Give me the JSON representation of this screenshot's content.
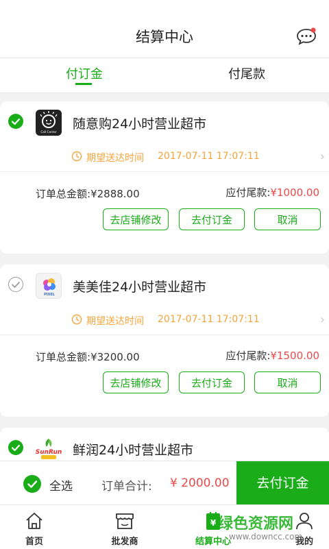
{
  "header": {
    "title": "结算中心"
  },
  "tabs": [
    {
      "label": "付订金"
    },
    {
      "label": "付尾款"
    }
  ],
  "orders": [
    {
      "store": "随意购24小时营业超市",
      "time_label": "期望送达时间",
      "time_value": "2017-07-11 17:07:11",
      "total_label": "订单总金额:",
      "total_value": "¥2888.00",
      "due_label": "应付尾款:",
      "due_value": "¥1000.00",
      "buttons": [
        "去店铺修改",
        "去付订金",
        "取消"
      ],
      "selected": true
    },
    {
      "store": "美美佳24小时营业超市",
      "time_label": "期望送达时间",
      "time_value": "2017-07-11 17:07:11",
      "total_label": "订单总金额:",
      "total_value": "¥3200.00",
      "due_label": "应付尾款:",
      "due_value": "¥1500.00",
      "buttons": [
        "去店铺修改",
        "去付订金",
        "取消"
      ],
      "selected": false
    },
    {
      "store": "鲜润24小时营业超市",
      "selected": true
    }
  ],
  "logos": {
    "logo1_text": "Call Center",
    "logo2_text": "PIXEL",
    "logo3_text": "SunRun"
  },
  "bottom": {
    "select_all": "全选",
    "total_label": "订单合计:",
    "total_value": "¥ 2000.00",
    "pay_button": "去付订金"
  },
  "nav": [
    {
      "label": "首页"
    },
    {
      "label": "批发商"
    },
    {
      "label": "结算中心"
    },
    {
      "label": "我的"
    }
  ],
  "watermark": {
    "line1": "绿色资源网",
    "line2": "www.downcc.com"
  },
  "colors": {
    "accent": "#1aad19",
    "price_red": "#e84a4a",
    "time_orange": "#f4a43a"
  }
}
